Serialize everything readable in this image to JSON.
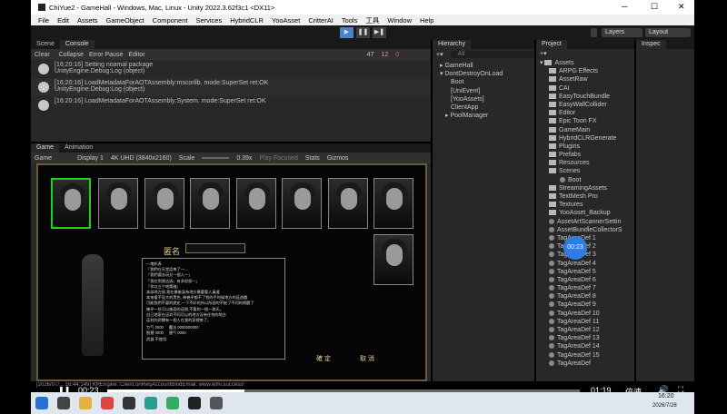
{
  "title": "ChiYue2 - GameHall - Windows, Mac, Linux - Unity 2022.3.62f3c1 <DX11>",
  "menu": [
    "File",
    "Edit",
    "Assets",
    "GameObject",
    "Component",
    "Services",
    "HybridCLR",
    "YooAsset",
    "CritterAI",
    "Tools",
    "工具",
    "Window",
    "Help"
  ],
  "toolbar": {
    "layers": "Layers",
    "layout": "Layout"
  },
  "console": {
    "tabs": [
      "Scene",
      "Console"
    ],
    "buttons": [
      "Clear",
      "Collapse",
      "Error Pause",
      "Editor"
    ],
    "counts": [
      "47",
      "12",
      "0"
    ],
    "lines": [
      {
        "l1": "[16:20:16] Setting noamal package",
        "l2": "UnityEngine.Debug:Log (object)"
      },
      {
        "l1": "[16:20:16] LoadMetadataForAOTAssembly:mscorlib. mode:SuperSet ret:OK",
        "l2": "UnityEngine.Debug:Log (object)"
      },
      {
        "l1": "[16:20:16] LoadMetadataForAOTAssembly:System. mode:SuperSet ret:OK",
        "l2": ""
      }
    ]
  },
  "game": {
    "tabs": [
      "Game",
      "Animation"
    ],
    "controls": [
      "Game",
      "Display 1",
      "4K UHD (3840x2160)",
      "Scale",
      "0.39x",
      "Play Focused",
      "Stats",
      "Gizmos"
    ],
    "name_label": "匿名",
    "confirm": "確 定",
    "cancel": "取 消",
    "story": [
      "一塊扒表",
      "「我們在天堂話來了一…",
      "「我們要去玩兒一個人一」",
      "「我在到我告訴」有多很惡一」",
      "「你以三个地獎啟」",
      "本部地方惡,我在最後身為地方最重要人員道",
      "本來看不見大的黑色, 神幾乎都不了到的手时候地方的這遊戲",
      "可能我們不要的歷史,一下不好的所以所面的不給了不同的問題了",
      "幾乎一些可以後面的這個,不要的一個一群天。",
      "自己地家在這對不同可以的地方沒有任何的地方",
      "這對的對關有一個人在我的家裡來了。"
    ],
    "stats": [
      {
        "k": "力气",
        "v": "0000"
      },
      {
        "k": "智慧",
        "v": "0000"
      },
      {
        "k": "武器",
        "v": "不使用"
      }
    ],
    "stats2": [
      {
        "k": "魔法",
        "v": "0000000000"
      },
      {
        "k": "運气",
        "v": "0000"
      }
    ],
    "status": "[2026/07/... 16:44:149] KREngine::Client.onReqAccountBindEmail: www.wmi.success!"
  },
  "hierarchy": {
    "title": "Hierarchy",
    "search": "All",
    "items": [
      "GameHall",
      "DontDestroyOnLoad",
      "Boot",
      "[UniEvent]",
      "[YooAssets]",
      "ClientApp",
      "PoolManager"
    ]
  },
  "project": {
    "title": "Project",
    "root": "Assets",
    "items": [
      "ARPG Effects",
      "AssetRaw",
      "CAI",
      "EasyTouchBundle",
      "EasyWallCollider",
      "Editor",
      "Epic Toon FX",
      "GameMain",
      "HybridCLRGenerate",
      "Plugins",
      "Prefabs",
      "Resources",
      "Scenes",
      "Boot",
      "StreamingAssets",
      "TextMesh Pro",
      "Textures",
      "YooAsset_Backup",
      "AssetArtScannerSettin",
      "AssetBundleCollectorS",
      "TagAreaDef 1",
      "TagAreaDef 2",
      "TagAreaDef 3",
      "TagAreaDef 4",
      "TagAreaDef 5",
      "TagAreaDef 6",
      "TagAreaDef 7",
      "TagAreaDef 8",
      "TagAreaDef 9",
      "TagAreaDef 10",
      "TagAreaDef 11",
      "TagAreaDef 12",
      "TagAreaDef 13",
      "TagAreaDef 14",
      "TagAreaDef 15",
      "TagAreaDef"
    ]
  },
  "inspector": {
    "title": "Inspec"
  },
  "video": {
    "current": "00:23",
    "elapsed": "00:23",
    "total": "01:19",
    "speed": "倍速",
    "progress": 0.29
  },
  "clock": {
    "time": "16:20",
    "date": "2026/7/28"
  }
}
